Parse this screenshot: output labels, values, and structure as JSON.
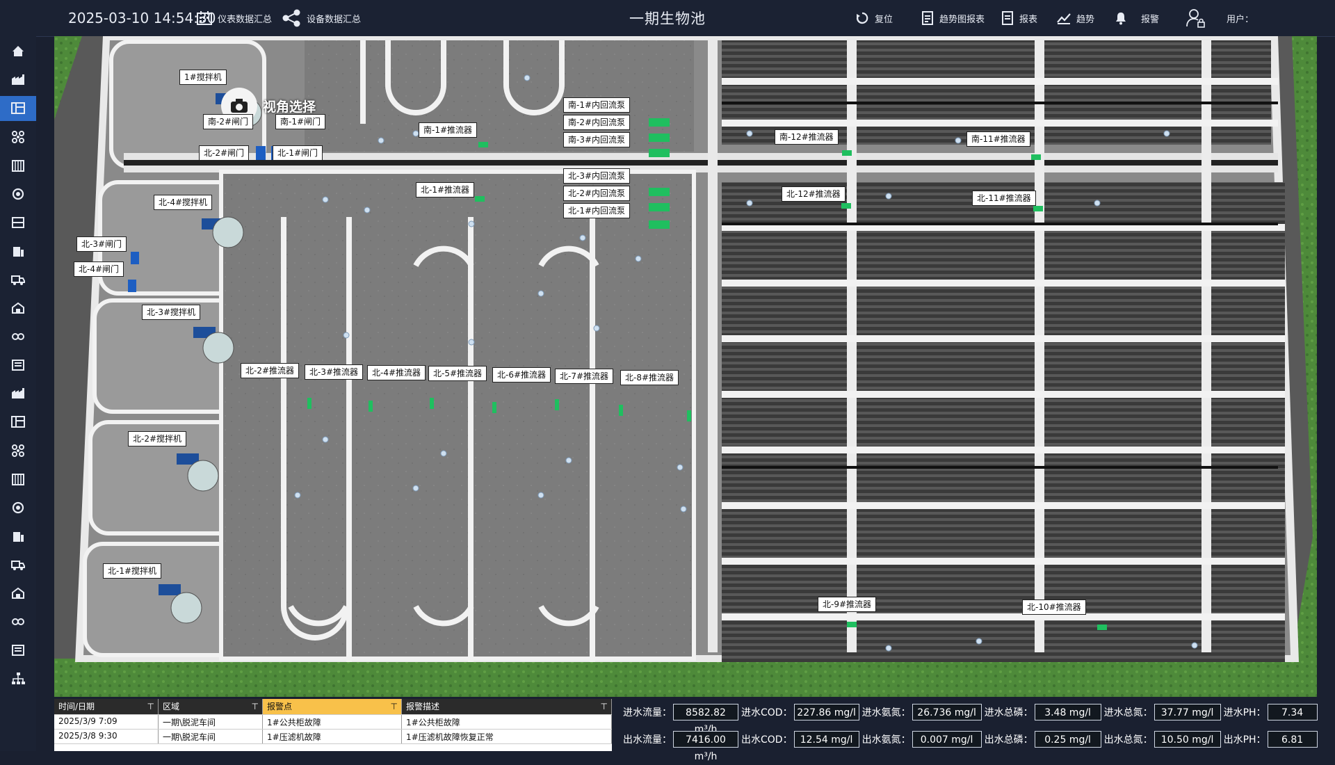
{
  "header": {
    "datetime": "2025-03-10 14:54:30",
    "title": "一期生物池",
    "meter_summary": "仪表数据汇总",
    "device_summary": "设备数据汇总",
    "reset": "复位",
    "trend_report": "趋势图报表",
    "report": "报表",
    "trend": "趋势",
    "alarm": "报警",
    "user": "用户："
  },
  "sidebar": {
    "active_index": 2,
    "icons": [
      "home-icon",
      "factory-icon",
      "layout-icon",
      "molecule-icon",
      "building-icon",
      "pump-icon",
      "panel-icon",
      "tank-icon",
      "truck-icon",
      "house-icon",
      "link-icon",
      "list-icon",
      "factory-icon",
      "layout-icon",
      "molecule-icon",
      "building-icon",
      "pump-icon",
      "tank-icon",
      "truck-icon",
      "house-icon",
      "link-icon",
      "list-icon",
      "tree-icon"
    ]
  },
  "scene": {
    "view_select": "视角选择",
    "labels": [
      {
        "text": "1#搅拌机"
      },
      {
        "text": "南-2#闸门"
      },
      {
        "text": "南-1#闸门"
      },
      {
        "text": "北-2#闸门"
      },
      {
        "text": "北-1#闸门"
      },
      {
        "text": "南-1#推流器"
      },
      {
        "text": "南-1#内回流泵"
      },
      {
        "text": "南-2#内回流泵"
      },
      {
        "text": "南-3#内回流泵"
      },
      {
        "text": "南-12#推流器"
      },
      {
        "text": "南-11#推流器"
      },
      {
        "text": "北-4#搅拌机"
      },
      {
        "text": "北-1#推流器"
      },
      {
        "text": "北-3#内回流泵"
      },
      {
        "text": "北-2#内回流泵"
      },
      {
        "text": "北-1#内回流泵"
      },
      {
        "text": "北-12#推流器"
      },
      {
        "text": "北-11#推流器"
      },
      {
        "text": "北-3#闸门"
      },
      {
        "text": "北-4#闸门"
      },
      {
        "text": "北-3#搅拌机"
      },
      {
        "text": "北-2#推流器"
      },
      {
        "text": "北-3#推流器"
      },
      {
        "text": "北-4#推流器"
      },
      {
        "text": "北-5#推流器"
      },
      {
        "text": "北-6#推流器"
      },
      {
        "text": "北-7#推流器"
      },
      {
        "text": "北-8#推流器"
      },
      {
        "text": "北-2#搅拌机"
      },
      {
        "text": "北-1#搅拌机"
      },
      {
        "text": "北-9#推流器"
      },
      {
        "text": "北-10#推流器"
      }
    ]
  },
  "alarm_table": {
    "columns": [
      "时间/日期",
      "区域",
      "报警点",
      "报警描述"
    ],
    "rows": [
      [
        "2025/3/9 7:09",
        "一期\\脱泥车间",
        "1#公共柜故障",
        "1#公共柜故障"
      ],
      [
        "2025/3/8 9:30",
        "一期\\脱泥车间",
        "1#压滤机故障",
        "1#压滤机故障恢复正常"
      ]
    ]
  },
  "water_quality": {
    "inlet": [
      {
        "name": "进水流量：",
        "value": "8582.82 m³/h"
      },
      {
        "name": "进水COD：",
        "value": "227.86  mg/l"
      },
      {
        "name": "进水氨氮：",
        "value": "26.736  mg/l"
      },
      {
        "name": "进水总磷：",
        "value": "3.48  mg/l"
      },
      {
        "name": "进水总氮：",
        "value": "37.77  mg/l"
      },
      {
        "name": "进水PH：",
        "value": "7.34"
      }
    ],
    "outlet": [
      {
        "name": "出水流量：",
        "value": "7416.00 m³/h"
      },
      {
        "name": "出水COD：",
        "value": "12.54 mg/l"
      },
      {
        "name": "出水氨氮：",
        "value": "0.007  mg/l"
      },
      {
        "name": "出水总磷：",
        "value": "0.25  mg/l"
      },
      {
        "name": "出水总氮：",
        "value": "10.50  mg/l"
      },
      {
        "name": "出水PH：",
        "value": "6.81"
      }
    ]
  }
}
